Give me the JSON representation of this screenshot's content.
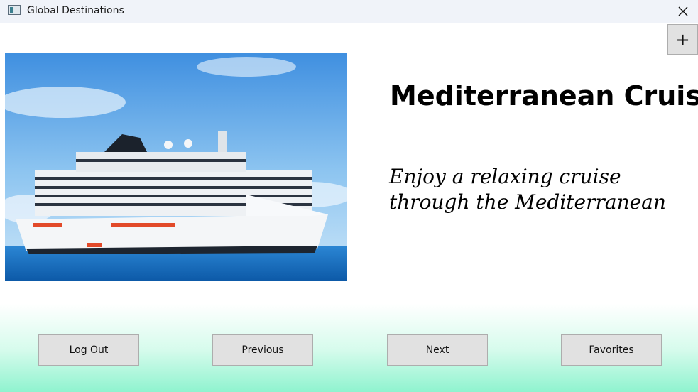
{
  "window": {
    "title": "Global Destinations",
    "icon": "app-window-icon",
    "close_icon": "close-icon"
  },
  "toolbar": {
    "add_label": "+"
  },
  "destination": {
    "image": "cruise-ship-image",
    "title": "Mediterranean Cruise",
    "description": "Enjoy a relaxing cruise through the Mediterranean"
  },
  "buttons": {
    "logout": "Log Out",
    "previous": "Previous",
    "next": "Next",
    "favorites": "Favorites"
  },
  "colors": {
    "gradient_bottom": "#8ff3cf",
    "button_bg": "#e1e1e1",
    "sea": "#1f77c9",
    "sky": "#6fb3ec"
  }
}
